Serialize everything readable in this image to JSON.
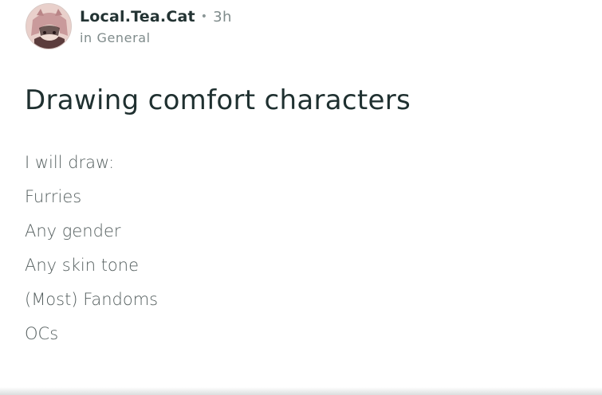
{
  "post": {
    "author": "Local.Tea.Cat",
    "separator": "•",
    "time_ago": "3h",
    "community": "in General",
    "title": "Drawing comfort characters",
    "lines": [
      "I will draw:",
      "Furries",
      "Any gender",
      "Any skin tone",
      "(Most) Fandoms",
      "OCs"
    ]
  },
  "icons": {
    "avatar": "user-avatar-icon"
  },
  "colors": {
    "title": "#1f3030",
    "body_text": "#555f5f",
    "meta_text": "#7f8b8b"
  }
}
